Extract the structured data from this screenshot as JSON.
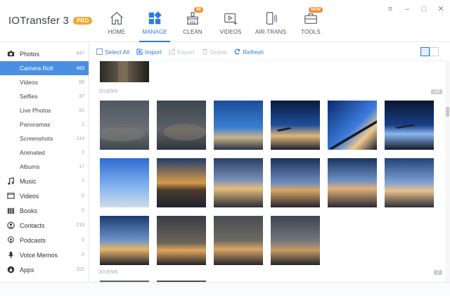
{
  "app": {
    "title": "IOTransfer 3",
    "badge": "PRO"
  },
  "nav": [
    {
      "label": "HOME",
      "icon": "home-icon",
      "badge": ""
    },
    {
      "label": "MANAGE",
      "icon": "manage-icon",
      "badge": "",
      "active": true
    },
    {
      "label": "CLEAN",
      "icon": "clean-icon",
      "badge": "88"
    },
    {
      "label": "VIDEOS",
      "icon": "videos-icon",
      "badge": ""
    },
    {
      "label": "AIR-TRANS",
      "icon": "air-trans-icon",
      "badge": ""
    },
    {
      "label": "TOOLS",
      "icon": "tools-icon",
      "badge": "NEW"
    }
  ],
  "sidebar": {
    "photos": {
      "label": "Photos",
      "count": "847"
    },
    "photo_items": [
      {
        "label": "Camera Roll",
        "count": "483",
        "selected": true
      },
      {
        "label": "Videos",
        "count": "88"
      },
      {
        "label": "Selfies",
        "count": "37"
      },
      {
        "label": "Live Photos",
        "count": "91"
      },
      {
        "label": "Panoramas",
        "count": "2"
      },
      {
        "label": "Screenshots",
        "count": "114"
      },
      {
        "label": "Animated",
        "count": "2"
      },
      {
        "label": "Albums",
        "count": "17"
      }
    ],
    "categories": [
      {
        "label": "Music",
        "count": "1",
        "icon": "music-icon"
      },
      {
        "label": "Videos",
        "count": "0",
        "icon": "video-icon"
      },
      {
        "label": "Books",
        "count": "0",
        "icon": "books-icon"
      },
      {
        "label": "Contacts",
        "count": "218",
        "icon": "contacts-icon"
      },
      {
        "label": "Podcasts",
        "count": "0",
        "icon": "podcasts-icon"
      },
      {
        "label": "Voice Memos",
        "count": "0",
        "icon": "voice-memos-icon"
      },
      {
        "label": "Apps",
        "count": "102",
        "icon": "apps-icon"
      }
    ]
  },
  "toolbar": {
    "select_all": "Select All",
    "import": "Import",
    "export": "Export",
    "delete": "Delete",
    "refresh": "Refresh"
  },
  "content": {
    "groups": [
      {
        "date": "2018/9/9",
        "count": "16"
      },
      {
        "date": "2018/9/8",
        "count": "2"
      }
    ]
  },
  "colors": {
    "accent": "#2d7be5",
    "selected_bg": "#4a90e2",
    "pro_badge": "#f6a62b",
    "nav_badge": "#f28a2a"
  }
}
